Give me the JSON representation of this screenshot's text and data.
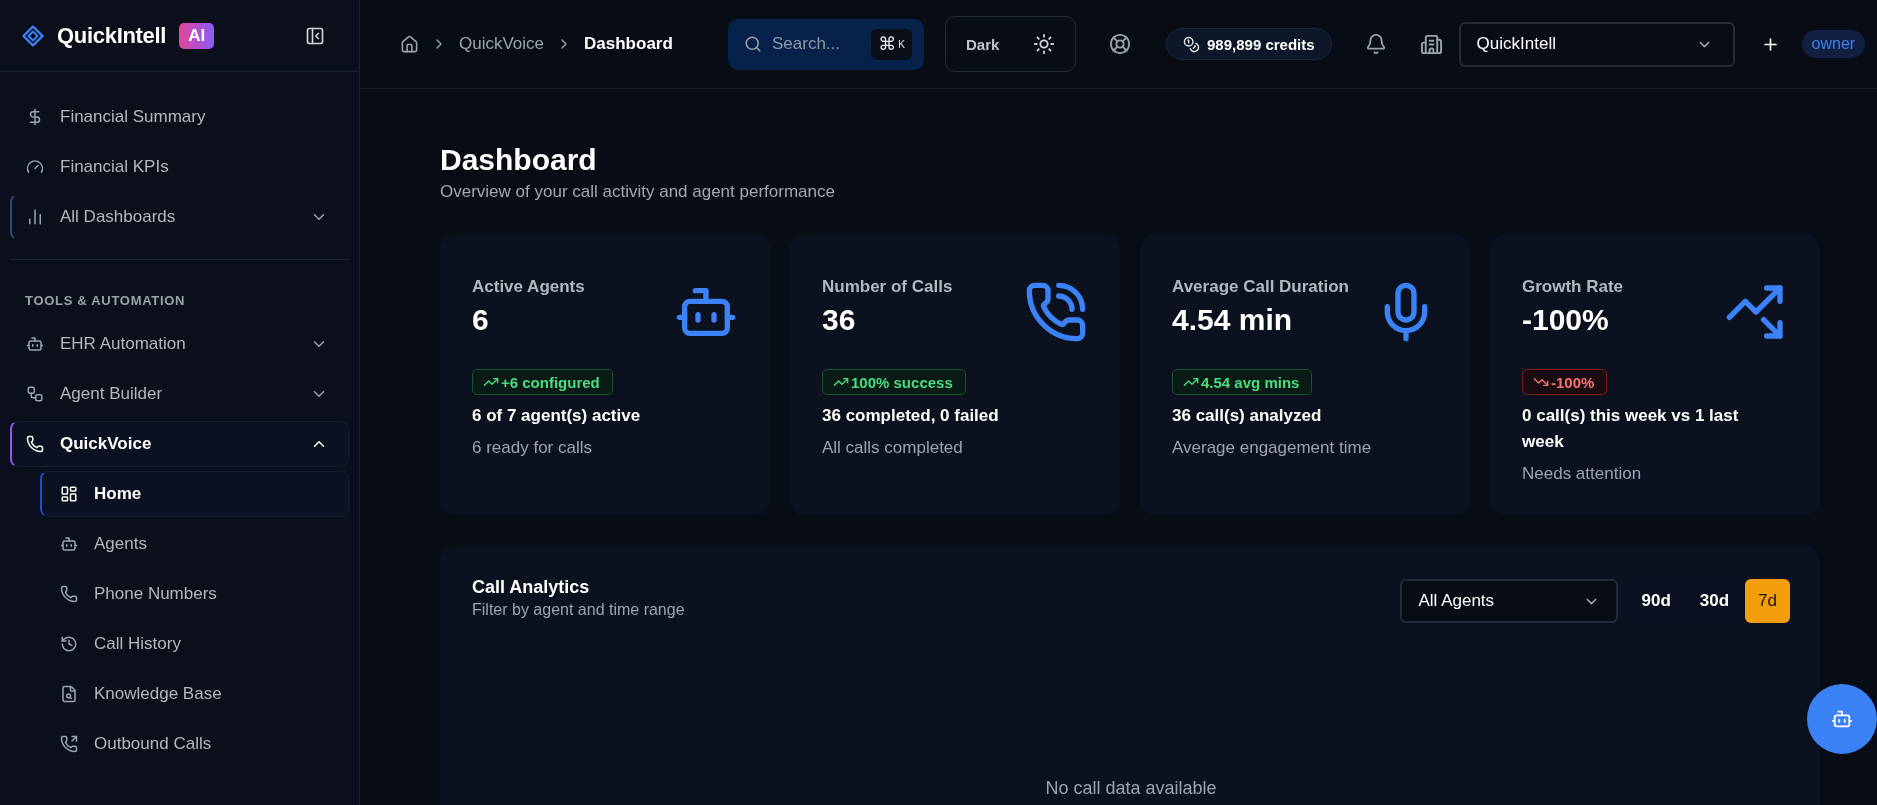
{
  "sidebar": {
    "brand": "QuickIntell",
    "brand_badge": "AI",
    "items": [
      {
        "kind": "link",
        "label": "Financial Summary",
        "selected": false,
        "focused": false
      },
      {
        "kind": "link",
        "label": "Financial KPIs",
        "selected": false,
        "focused": false
      },
      {
        "kind": "group",
        "label": "All Dashboards",
        "selected": false,
        "focused": true,
        "expanded": false
      }
    ],
    "sections": [
      {
        "heading": "TOOLS & AUTOMATION",
        "items": [
          {
            "kind": "group",
            "label": "EHR Automation",
            "selected": false,
            "focused": false,
            "expanded": false
          },
          {
            "kind": "group",
            "label": "Agent Builder",
            "selected": false,
            "focused": false,
            "expanded": false
          },
          {
            "kind": "group",
            "label": "QuickVoice",
            "selected": true,
            "focused": false,
            "expanded": true,
            "children": [
              {
                "label": "Home",
                "selected": true
              },
              {
                "label": "Agents",
                "selected": false
              },
              {
                "label": "Phone Numbers",
                "selected": false
              },
              {
                "label": "Call History",
                "selected": false
              },
              {
                "label": "Knowledge Base",
                "selected": false
              },
              {
                "label": "Outbound Calls",
                "selected": false
              }
            ]
          }
        ]
      }
    ]
  },
  "topbar": {
    "breadcrumb": [
      {
        "label": "QuickVoice",
        "current": false
      },
      {
        "label": "Dashboard",
        "current": true
      }
    ],
    "search": {
      "placeholder": "Search...",
      "shortcut_modifier": "⌘",
      "shortcut_key": "K"
    },
    "theme_button": "Dark",
    "credits": "989,899 credits",
    "organization": "QuickIntell",
    "role": "owner"
  },
  "page": {
    "title": "Dashboard",
    "subtitle": "Overview of your call activity and agent performance"
  },
  "stats": [
    {
      "kind": "up",
      "label": "Active Agents",
      "value": "6",
      "trend": "+6 configured",
      "detail": "6 of 7 agent(s) active",
      "note": "6 ready for calls"
    },
    {
      "kind": "up",
      "label": "Number of Calls",
      "value": "36",
      "trend": "100% success",
      "detail": "36 completed, 0 failed",
      "note": "All calls completed"
    },
    {
      "kind": "up",
      "label": "Average Call Duration",
      "value": "4.54 min",
      "trend": "4.54 avg mins",
      "detail": "36 call(s) analyzed",
      "note": "Average engagement time"
    },
    {
      "kind": "down",
      "label": "Growth Rate",
      "value": "-100%",
      "trend": "-100%",
      "detail": "0 call(s) this week vs 1 last week",
      "note": "Needs attention"
    }
  ],
  "analytics": {
    "title": "Call Analytics",
    "subtitle": "Filter by agent and time range",
    "agent_filter": "All Agents",
    "ranges": [
      {
        "label": "90d",
        "selected": false
      },
      {
        "label": "30d",
        "selected": false
      },
      {
        "label": "7d",
        "selected": true
      }
    ],
    "empty_message": "No call data available"
  }
}
